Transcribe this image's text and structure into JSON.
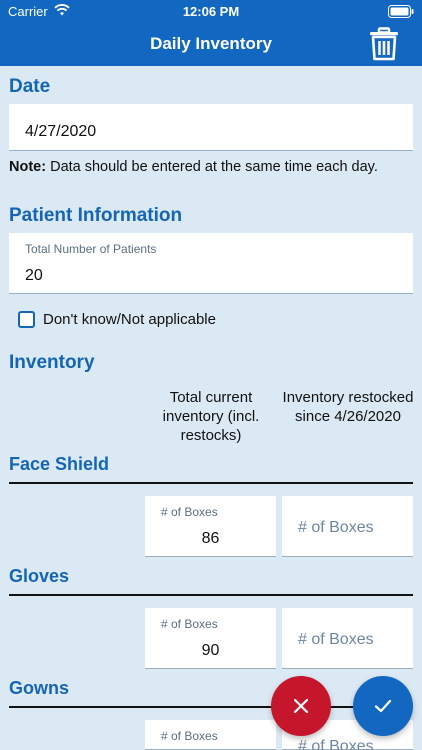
{
  "status_bar": {
    "carrier": "Carrier",
    "time": "12:06 PM"
  },
  "nav": {
    "title": "Daily Inventory",
    "delete_icon": "trash-icon"
  },
  "date_section": {
    "title": "Date",
    "value": "4/27/2020"
  },
  "note": {
    "prefix": "Note:",
    "text": " Data should be entered at the same time each day."
  },
  "patient_section": {
    "title": "Patient Information",
    "field_label": "Total Number of Patients",
    "field_value": "20",
    "checkbox_label": "Don't know/Not applicable",
    "checkbox_checked": false
  },
  "inventory_section": {
    "title": "Inventory",
    "col_current": "Total current inventory (incl. restocks)",
    "col_restocked": "Inventory restocked since 4/26/2020"
  },
  "items": [
    {
      "name": "Face Shield",
      "current_label": "# of Boxes",
      "current_value": "86",
      "restocked_placeholder": "# of Boxes"
    },
    {
      "name": "Gloves",
      "current_label": "# of Boxes",
      "current_value": "90",
      "restocked_placeholder": "# of Boxes"
    },
    {
      "name": "Gowns",
      "current_label": "# of Boxes",
      "current_value": "",
      "restocked_placeholder": "# of Boxes"
    }
  ],
  "colors": {
    "primary": "#1268c0",
    "accent_text": "#1565b5",
    "background": "#dbe9f4",
    "cancel": "#c5162b"
  },
  "fab": {
    "cancel_icon": "close-icon",
    "confirm_icon": "checkmark-icon"
  }
}
